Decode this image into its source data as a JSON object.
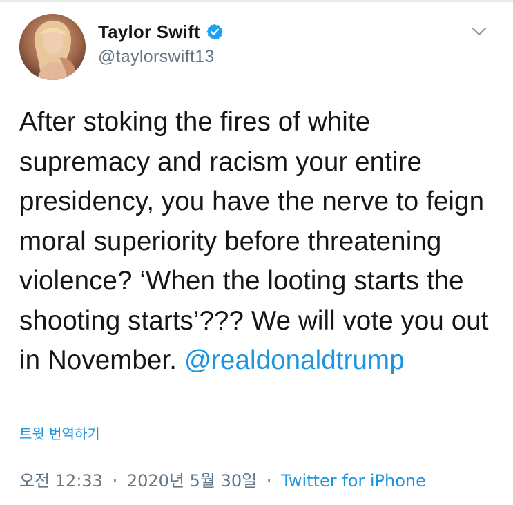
{
  "user": {
    "display_name": "Taylor Swift",
    "handle": "@taylorswift13",
    "verified": true,
    "avatar_icon": "profile-photo"
  },
  "tweet": {
    "text": "After stoking the fires of white supremacy and racism your entire presidency, you have the nerve to feign moral superiority before threatening violence? ‘When the looting starts the shooting starts’??? We will vote you out in November.",
    "mention": "@realdonaldtrump",
    "translate_label": "트윗 번역하기",
    "time": "오전 12:33",
    "date": "2020년 5월 30일",
    "separator": "·",
    "source": "Twitter for iPhone"
  },
  "colors": {
    "link": "#1b95e0",
    "text": "#14171a",
    "muted": "#657786",
    "verified": "#1da1f2"
  },
  "icons": {
    "verified": "verified-badge-icon",
    "menu": "chevron-down-icon"
  }
}
